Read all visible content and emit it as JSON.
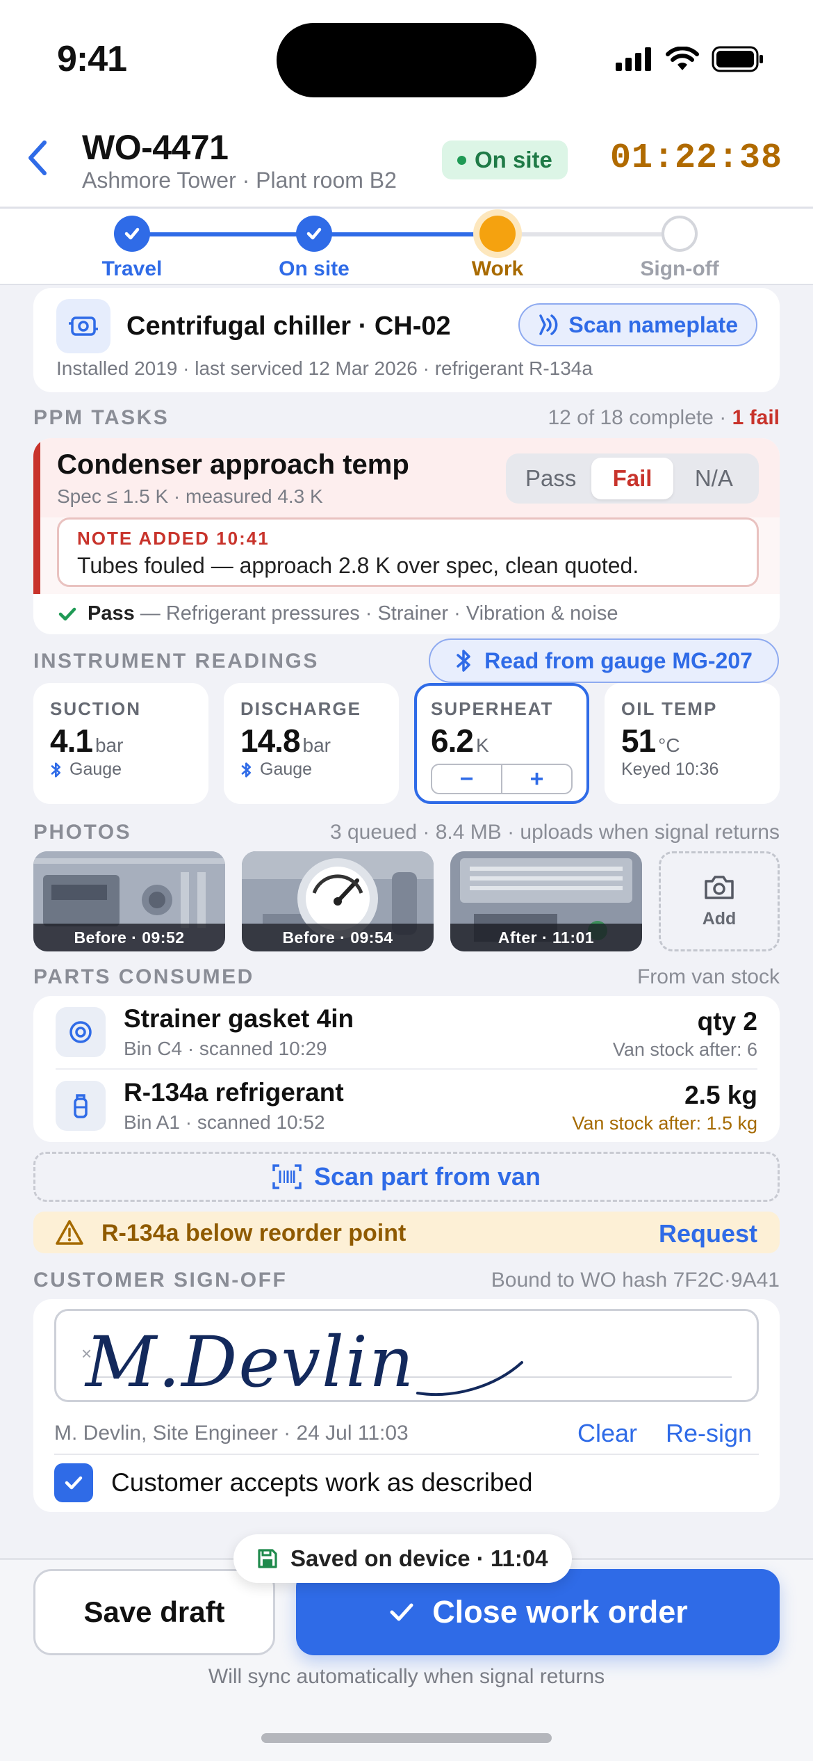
{
  "status_bar": {
    "time": "9:41",
    "signal_icon": "cellular-signal-icon",
    "wifi_icon": "wifi-icon",
    "battery_icon": "battery-icon"
  },
  "header": {
    "back_icon": "chevron-left-icon",
    "title": "WO-4471",
    "subtitle": "Ashmore Tower · Plant room B2",
    "status_badge": "On site",
    "timer": "01:22:38",
    "colors": {
      "accent": "#2f6be7",
      "status_green": "#1f7a47",
      "timer": "#b06a00"
    }
  },
  "stepper": {
    "steps": [
      {
        "label": "Travel",
        "state": "done"
      },
      {
        "label": "On site",
        "state": "done"
      },
      {
        "label": "Work",
        "state": "current"
      },
      {
        "label": "Sign-off",
        "state": "todo"
      }
    ]
  },
  "equipment": {
    "icon": "equipment-icon",
    "name": "Centrifugal chiller · CH-02",
    "meta": "Installed 2019 · last serviced 12 Mar 2026 · refrigerant R-134a",
    "scan_label": "Scan nameplate",
    "scan_icon": "nfc-scan-icon"
  },
  "ppm": {
    "label": "PPM TASKS",
    "progress": "12 of 18 complete",
    "separator": "·",
    "fail_count": "1 fail",
    "task": {
      "name": "Condenser approach temp",
      "spec": "Spec ≤ 1.5 K · measured 4.3 K",
      "options": [
        "Pass",
        "Fail",
        "N/A"
      ],
      "selected": "Fail",
      "note_header": "NOTE ADDED 10:41",
      "note_body": "Tubes fouled — approach 2.8 K over spec, clean quoted."
    },
    "pass_label": "Pass",
    "pass_items": "— Refrigerant pressures · Strainer · Vibration & noise"
  },
  "instruments": {
    "label": "INSTRUMENT READINGS",
    "gauge_button": "Read from gauge MG-207",
    "readings": [
      {
        "label": "SUCTION",
        "value": "4.1",
        "unit": "bar",
        "source": "Gauge"
      },
      {
        "label": "DISCHARGE",
        "value": "14.8",
        "unit": "bar",
        "source": "Gauge"
      },
      {
        "label": "SUPERHEAT",
        "value": "6.2",
        "unit": "K",
        "minus": "−",
        "plus": "+"
      },
      {
        "label": "OIL TEMP",
        "value": "51",
        "unit": "°C",
        "source": "Keyed 10:36"
      }
    ]
  },
  "photos": {
    "label": "PHOTOS",
    "meta": "3 queued · 8.4 MB · uploads when signal returns",
    "items": [
      {
        "caption": "Before · 09:52"
      },
      {
        "caption": "Before · 09:54"
      },
      {
        "caption": "After · 11:01"
      }
    ],
    "add_label": "Add",
    "add_icon": "camera-icon"
  },
  "parts": {
    "label": "PARTS CONSUMED",
    "meta": "From van stock",
    "items": [
      {
        "icon": "gasket-icon",
        "name": "Strainer gasket 4in",
        "meta": "Bin C4 · scanned 10:29",
        "qty": "qty 2",
        "stock": "Van stock after: 6"
      },
      {
        "icon": "refrigerant-cylinder-icon",
        "name": "R-134a refrigerant",
        "meta": "Bin A1 · scanned 10:52",
        "qty": "2.5 kg",
        "stock": "Van stock after: 1.5 kg"
      }
    ],
    "scan_label": "Scan part from van",
    "alert_text": "R-134a below reorder point",
    "alert_action": "Request"
  },
  "signoff": {
    "label": "CUSTOMER SIGN-OFF",
    "meta": "Bound to WO hash 7F2C·9A41",
    "signature_x": "×",
    "signature_text": "M.Devlin",
    "signer": "M. Devlin, Site Engineer · 24 Jul 11:03",
    "clear": "Clear",
    "resign": "Re-sign",
    "accept_label": "Customer accepts work as described",
    "accepted": true
  },
  "footer": {
    "saved": "Saved on device · 11:04",
    "save_draft": "Save draft",
    "close": "Close work order",
    "sync_note": "Will sync automatically when signal returns"
  }
}
